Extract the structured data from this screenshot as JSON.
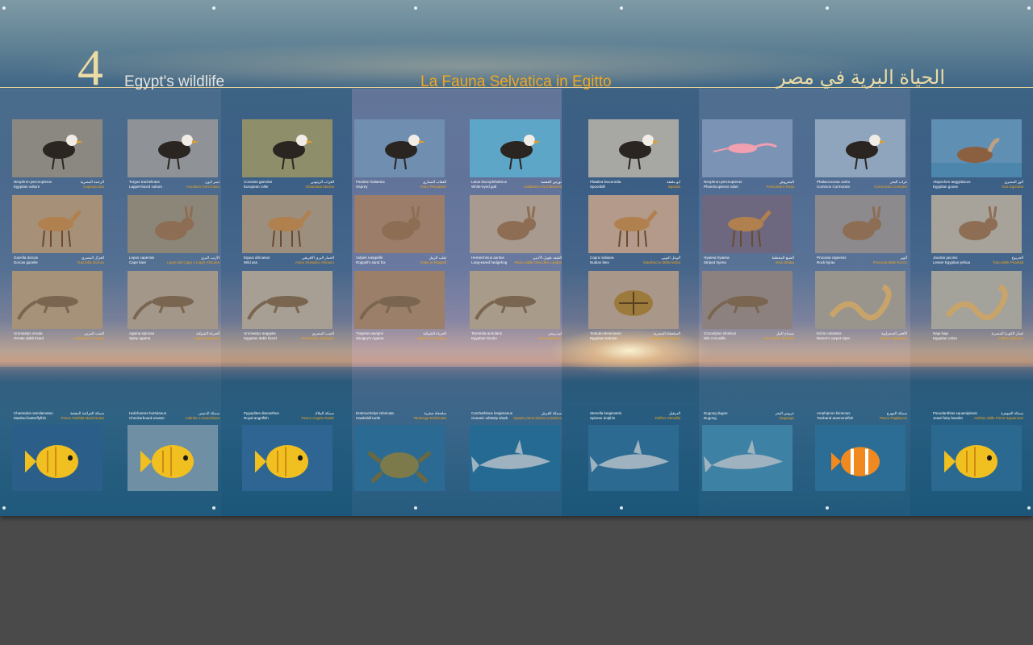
{
  "header": {
    "chapter_number": "4",
    "title_en": "Egypt's wildlife",
    "title_it": "La Fauna Selvatica in Egitto",
    "title_ar": "الحياة البرية في مصر"
  },
  "colors": {
    "title_italian": "#f2a81f",
    "chapter_number": "#ecdba4",
    "caption_italian": "#f3a51c",
    "caption_text": "#ffffff",
    "background": "#4a4a4a"
  },
  "rows": [
    {
      "kind": "land",
      "cards": [
        {
          "latin": "Neophron percnopterus",
          "arabic": "الرخمة المصرية",
          "english": "Egyptian vulture",
          "italian": "Capovaccaio",
          "icon": "bird-icon",
          "bg": "#8a8880"
        },
        {
          "latin": "Torgos tracheliotus",
          "arabic": "نسر أذون",
          "english": "Lappet-faced vulture",
          "italian": "Avvoltoio Orecchiuto",
          "icon": "bird-icon",
          "bg": "#8f9296"
        },
        {
          "latin": "Coracias garrulus",
          "arabic": "الغراب الزيتوني",
          "english": "European roller",
          "italian": "Ghiandaia Marina",
          "icon": "bird-icon",
          "bg": "#8f8e6a"
        },
        {
          "latin": "Pandion haliaetus",
          "arabic": "العقاب النساري",
          "english": "Osprey",
          "italian": "Falco Pescatore",
          "icon": "bird-icon",
          "bg": "#6f8eb0"
        },
        {
          "latin": "Larus leucophthalmus",
          "arabic": "نورس العفصة",
          "english": "White-eyed gull",
          "italian": "Gabbiano Occhibianchi",
          "icon": "bird-icon",
          "bg": "#5da6c8"
        },
        {
          "latin": "Platalea leucorodia",
          "arabic": "أبو ملعقة",
          "english": "Spoonbill",
          "italian": "Spatola",
          "icon": "bird-icon",
          "bg": "#a7a8a3"
        },
        {
          "latin": "Neophron percnopterus",
          "arabic": "البشروش",
          "english": "Phoenicopterus ruber",
          "italian": "Fenicottero Rosa",
          "icon": "flamingo-icon",
          "bg": "#7b93b5"
        },
        {
          "latin": "Phalacrocorax carbo",
          "arabic": "غراب البحر",
          "english": "Common Cormorant",
          "italian": "Cormorano Comune",
          "icon": "bird-icon",
          "bg": "#8ea5bd"
        },
        {
          "latin": "Alopochen aegyptiacus",
          "arabic": "الوز المصري",
          "english": "Egyptian goose",
          "italian": "Oca Egiziana",
          "icon": "goose-icon",
          "bg": "#5f8fb3"
        }
      ]
    },
    {
      "kind": "land",
      "cards": [
        {
          "latin": "Gazella dorcas",
          "arabic": "الغزال المصري",
          "english": "Dorcas gazelle",
          "italian": "Gazzella Dorcas",
          "icon": "gazelle-icon",
          "bg": "#a69077"
        },
        {
          "latin": "Lepus capensis",
          "arabic": "الأرنب البري",
          "english": "Cape hare",
          "italian": "Lepre del Capo o Lepre Africana",
          "icon": "hare-icon",
          "bg": "#8b8677"
        },
        {
          "latin": "Equus africanus",
          "arabic": "الحمار البري الأفريقي",
          "english": "Wild ass",
          "italian": "Asino Selvatico Africano",
          "icon": "donkey-icon",
          "bg": "#9c8f7e"
        },
        {
          "latin": "Vulpes rueppellii",
          "arabic": "ثعلب الرمل",
          "english": "Rüppell's sand fox",
          "italian": "Volpe di Rüppell",
          "icon": "fox-icon",
          "bg": "#9c7d6a"
        },
        {
          "latin": "Hemiechinus auritus",
          "arabic": "القنفذ طويل الأذنين",
          "english": "Long-eared hedgehog",
          "italian": "Riccio dalle Orecchie Lunghe",
          "icon": "hedgehog-icon",
          "bg": "#a89a8e"
        },
        {
          "latin": "Capra nubiana",
          "arabic": "الوعل النوبي",
          "english": "Nubian ibex",
          "italian": "Stambecco della Nubia",
          "icon": "ibex-icon",
          "bg": "#b39a8b"
        },
        {
          "latin": "Hyaena hyaena",
          "arabic": "الضبع المخطط",
          "english": "Striped hyena",
          "italian": "Iena Striata",
          "icon": "hyena-icon",
          "bg": "#6d6880"
        },
        {
          "latin": "Procavia capensis",
          "arabic": "الوبر",
          "english": "Rock hyrax",
          "italian": "Procavia delle Rocce",
          "icon": "hyrax-icon",
          "bg": "#8c8a8d"
        },
        {
          "latin": "Jaculus jaculus",
          "arabic": "الجربوع",
          "english": "Lesser Egyptian jerboa",
          "italian": "Topo delle Piramidi",
          "icon": "jerboa-icon",
          "bg": "#a8a39a"
        }
      ]
    },
    {
      "kind": "land",
      "cards": [
        {
          "latin": "Uromastyx ornata",
          "arabic": "الضب المزين",
          "english": "Ornate dabb lizard",
          "italian": "Uromastice Ornato",
          "icon": "lizard-icon",
          "bg": "#a69279"
        },
        {
          "latin": "Agama spinosa",
          "arabic": "الحرباء الشوكية",
          "english": "Spiny agama",
          "italian": "Agama Spinosa",
          "icon": "lizard-icon",
          "bg": "#a3978a"
        },
        {
          "latin": "Uromastyx aegyptia",
          "arabic": "الضب المصري",
          "english": "Egyptian dabb lizard",
          "italian": "Uromastice Egiziano",
          "icon": "lizard-icon",
          "bg": "#a79f93"
        },
        {
          "latin": "Trapelus savignii",
          "arabic": "الحرباء الشوكية",
          "english": "Savigny's Agama",
          "italian": "Agama di Savigny",
          "icon": "lizard-icon",
          "bg": "#9c7f68"
        },
        {
          "latin": "Tarentola annularis",
          "arabic": "أبو بريص",
          "english": "Egyptian Gecko",
          "italian": "Geco Egiziano",
          "icon": "gecko-icon",
          "bg": "#a89b8a"
        },
        {
          "latin": "Testudo kleinmanni",
          "arabic": "السلحفاة المصرية",
          "english": "Egyptian tortoise",
          "italian": "Testuggine d'Egitto",
          "icon": "tortoise-icon",
          "bg": "#a99789"
        },
        {
          "latin": "Crocodylus niloticus",
          "arabic": "تمساح النيل",
          "english": "Nile crocodile",
          "italian": "Coccodrillo del Nilo",
          "icon": "crocodile-icon",
          "bg": "#8d8180"
        },
        {
          "latin": "Echis coloratus",
          "arabic": "الأفعى الصحراوية",
          "english": "Burton's carpet viper",
          "italian": "Vipera Tappetata",
          "icon": "snake-icon",
          "bg": "#9a958c"
        },
        {
          "latin": "Naja haje",
          "arabic": "ثعبان الكوبرا المصرية",
          "english": "Egyptian cobra",
          "italian": "Cobra Egiziano",
          "icon": "cobra-icon",
          "bg": "#a3a29b"
        }
      ]
    },
    {
      "kind": "sea",
      "cards": [
        {
          "latin": "Chaetodon semilarvatus",
          "arabic": "سمكة الفراشة المقنعة",
          "english": "Masked butterflyfish",
          "italian": "Pesce Farfalla Mascherato",
          "icon": "fish-icon",
          "bg": "#2b5f8a"
        },
        {
          "latin": "Halichoeres hortulanus",
          "arabic": "سمكة الدنيس",
          "english": "Checkerboard wrasse",
          "italian": "Labride a Scacchiera",
          "icon": "fish-icon",
          "bg": "#6e8fa4"
        },
        {
          "latin": "Pygoplites diacanthus",
          "arabic": "سمكة الملاك",
          "english": "Royal angelfish",
          "italian": "Pesce Angelo Reale",
          "icon": "fish-icon",
          "bg": "#2e6592"
        },
        {
          "latin": "Eretmochelys imbricata",
          "arabic": "سلحفاة صقرية",
          "english": "Hawksbill turtle",
          "italian": "Tartaruga Embricata",
          "icon": "turtle-icon",
          "bg": "#2a6a93"
        },
        {
          "latin": "Carcharhinus longimanus",
          "arabic": "سمكة القرش",
          "english": "Oceanic whitetip shark",
          "italian": "Squalo pinna bianca oceanico",
          "icon": "shark-icon",
          "bg": "#246a93"
        },
        {
          "latin": "Stenella longirostris",
          "arabic": "الدرفيل",
          "english": "Spinner dolphin",
          "italian": "Delfino Stenella",
          "icon": "dolphin-icon",
          "bg": "#2c6a92"
        },
        {
          "latin": "Dugong dugon",
          "arabic": "عروس البحر",
          "english": "Dugong",
          "italian": "Dugongo",
          "icon": "dugong-icon",
          "bg": "#3d81a4"
        },
        {
          "latin": "Amphiprion bicinctus",
          "arabic": "سمكة المهرج",
          "english": "Twoband anemonefish",
          "italian": "Pesce Pagliaccio",
          "icon": "clownfish-icon",
          "bg": "#2b6d95"
        },
        {
          "latin": "Pseudanthias squamipinnis",
          "arabic": "سمكة الجوهرة",
          "english": "Jewel fairy basslet",
          "italian": "Anthias dalle Pinne Squamose",
          "icon": "fish-icon",
          "bg": "#2b6991"
        }
      ]
    }
  ]
}
